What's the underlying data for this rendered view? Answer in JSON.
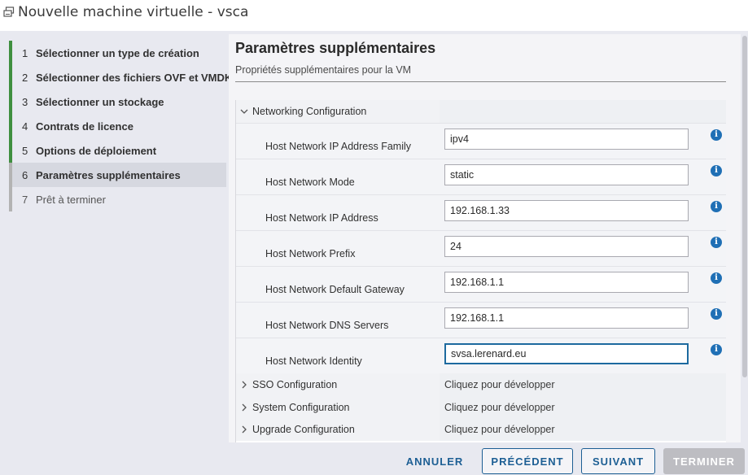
{
  "window": {
    "title": "Nouvelle machine virtuelle - vsca"
  },
  "steps": [
    {
      "num": "1",
      "label": "Sélectionner un type de création",
      "state": "done"
    },
    {
      "num": "2",
      "label": "Sélectionner des fichiers OVF et VMDK",
      "state": "done"
    },
    {
      "num": "3",
      "label": "Sélectionner un stockage",
      "state": "done"
    },
    {
      "num": "4",
      "label": "Contrats de licence",
      "state": "done"
    },
    {
      "num": "5",
      "label": "Options de déploiement",
      "state": "done"
    },
    {
      "num": "6",
      "label": "Paramètres supplémentaires",
      "state": "active"
    },
    {
      "num": "7",
      "label": "Prêt à terminer",
      "state": "pending"
    }
  ],
  "page": {
    "heading": "Paramètres supplémentaires",
    "subheading": "Propriétés supplémentaires pour la VM"
  },
  "groups": {
    "networking": {
      "label": "Networking Configuration",
      "expanded": true
    },
    "sso": {
      "label": "SSO Configuration",
      "value": "Cliquez pour développer"
    },
    "system": {
      "label": "System Configuration",
      "value": "Cliquez pour développer"
    },
    "upgrade": {
      "label": "Upgrade Configuration",
      "value": "Cliquez pour développer"
    }
  },
  "properties": [
    {
      "key": "Host Network IP Address Family",
      "value": "ipv4"
    },
    {
      "key": "Host Network Mode",
      "value": "static"
    },
    {
      "key": "Host Network IP Address",
      "value": "192.168.1.33"
    },
    {
      "key": "Host Network Prefix",
      "value": "24"
    },
    {
      "key": "Host Network Default Gateway",
      "value": "192.168.1.1"
    },
    {
      "key": "Host Network DNS Servers",
      "value": "192.168.1.1"
    },
    {
      "key": "Host Network Identity",
      "value": "svsa.lerenard.eu"
    }
  ],
  "info_glyph": "i",
  "footer": {
    "cancel": "ANNULER",
    "previous": "PRÉCÉDENT",
    "next": "SUIVANT",
    "finish": "TERMINER"
  },
  "colors": {
    "accent": "#1d5f94",
    "step_done": "#3f8f3f",
    "info": "#1f6fb5"
  }
}
